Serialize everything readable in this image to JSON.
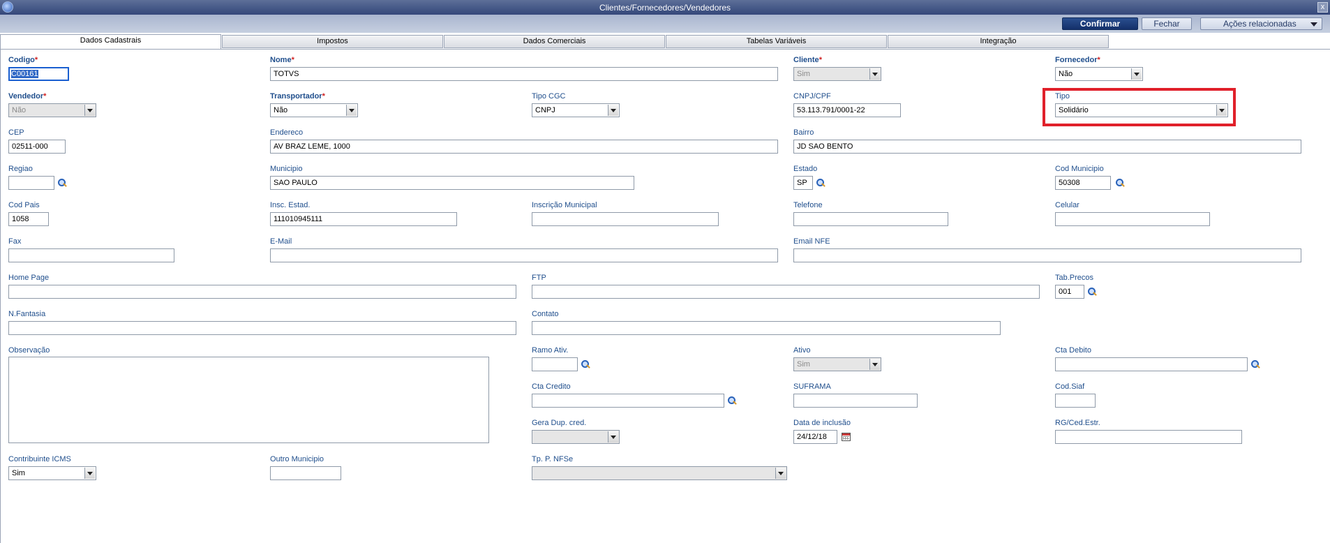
{
  "window": {
    "title": "Clientes/Fornecedores/Vendedores",
    "close": "x"
  },
  "toolbar": {
    "confirm": "Confirmar",
    "close": "Fechar",
    "related": "Ações relacionadas"
  },
  "tabs": [
    "Dados Cadastrais",
    "Impostos",
    "Dados Comerciais",
    "Tabelas Variáveis",
    "Integração"
  ],
  "fields": {
    "codigo": {
      "label": "Codigo",
      "value": "C00161"
    },
    "nome": {
      "label": "Nome",
      "value": "TOTVS"
    },
    "cliente": {
      "label": "Cliente",
      "value": "Sim"
    },
    "fornecedor": {
      "label": "Fornecedor",
      "value": "Não"
    },
    "vendedor": {
      "label": "Vendedor",
      "value": "Não"
    },
    "transportador": {
      "label": "Transportador",
      "value": "Não"
    },
    "tipo_cgc": {
      "label": "Tipo CGC",
      "value": "CNPJ"
    },
    "cnpj": {
      "label": "CNPJ/CPF",
      "value": "53.113.791/0001-22"
    },
    "tipo": {
      "label": "Tipo",
      "value": "Solidário"
    },
    "cep": {
      "label": "CEP",
      "value": "02511-000"
    },
    "endereco": {
      "label": "Endereco",
      "value": "AV BRAZ LEME, 1000"
    },
    "bairro": {
      "label": "Bairro",
      "value": "JD SAO BENTO"
    },
    "regiao": {
      "label": "Regiao",
      "value": ""
    },
    "municipio": {
      "label": "Municipio",
      "value": "SAO PAULO"
    },
    "estado": {
      "label": "Estado",
      "value": "SP"
    },
    "cod_municipio": {
      "label": "Cod Municipio",
      "value": "50308"
    },
    "cod_pais": {
      "label": "Cod Pais",
      "value": "1058"
    },
    "insc_estad": {
      "label": "Insc. Estad.",
      "value": "111010945111"
    },
    "insc_municipal": {
      "label": "Inscrição Municipal",
      "value": ""
    },
    "telefone": {
      "label": "Telefone",
      "value": ""
    },
    "celular": {
      "label": "Celular",
      "value": ""
    },
    "fax": {
      "label": "Fax",
      "value": ""
    },
    "email": {
      "label": "E-Mail",
      "value": ""
    },
    "email_nfe": {
      "label": "Email NFE",
      "value": ""
    },
    "home_page": {
      "label": "Home Page",
      "value": ""
    },
    "ftp": {
      "label": "FTP",
      "value": ""
    },
    "tab_precos": {
      "label": "Tab.Precos",
      "value": "001"
    },
    "n_fantasia": {
      "label": "N.Fantasia",
      "value": ""
    },
    "contato": {
      "label": "Contato",
      "value": ""
    },
    "observacao": {
      "label": "Observação",
      "value": ""
    },
    "ramo_ativ": {
      "label": "Ramo Ativ.",
      "value": ""
    },
    "ativo": {
      "label": "Ativo",
      "value": "Sim"
    },
    "cta_debito": {
      "label": "Cta Debito",
      "value": ""
    },
    "cta_credito": {
      "label": "Cta Credito",
      "value": ""
    },
    "suframa": {
      "label": "SUFRAMA",
      "value": ""
    },
    "cod_siaf": {
      "label": "Cod.Siaf",
      "value": ""
    },
    "gera_dup": {
      "label": "Gera Dup. cred.",
      "value": ""
    },
    "data_inclusao": {
      "label": "Data de inclusão",
      "value": "24/12/18"
    },
    "rg_ced": {
      "label": "RG/Ced.Estr.",
      "value": ""
    },
    "contribuinte_icms": {
      "label": "Contribuinte ICMS",
      "value": "Sim"
    },
    "outro_municipio": {
      "label": "Outro Municipio",
      "value": ""
    },
    "tp_nfse": {
      "label": "Tp. P. NFSe",
      "value": ""
    }
  },
  "required_mark": "*",
  "colors": {
    "label": "#1f4e8c",
    "highlight": "#e0202a",
    "primary_button": "#14306a"
  }
}
